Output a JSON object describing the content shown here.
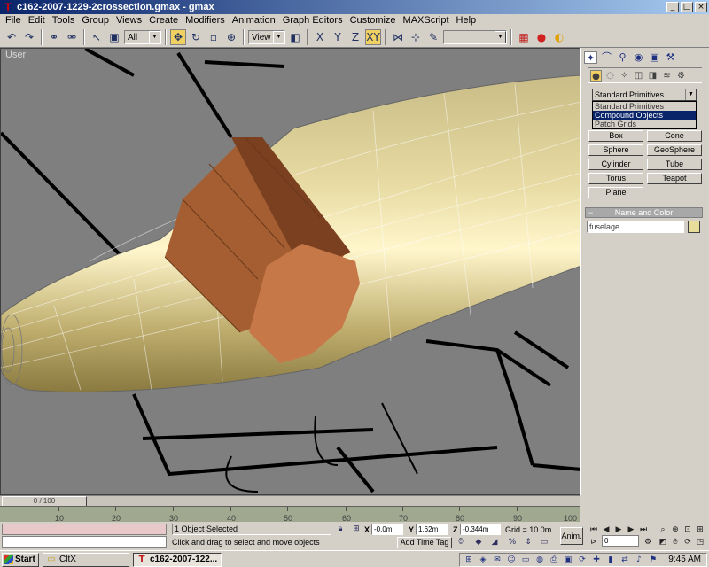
{
  "window": {
    "title": "c162-2007-1229-2crossection.gmax - gmax",
    "app_icon": "gmax-logo-icon",
    "minimize": "_",
    "maximize": "□",
    "close": "×"
  },
  "menu": {
    "items": [
      "File",
      "Edit",
      "Tools",
      "Group",
      "Views",
      "Create",
      "Modifiers",
      "Animation",
      "Graph Editors",
      "Customize",
      "MAXScript",
      "Help"
    ]
  },
  "toolbar": {
    "selection_filter": "All",
    "reference_coord": "View",
    "named_selection": ""
  },
  "viewport": {
    "label": "User"
  },
  "command_panel": {
    "category_selected": "Standard Primitives",
    "category_options": [
      "Standard Primitives",
      "Compound Objects",
      "Patch Grids"
    ],
    "highlighted_option": "Compound Objects",
    "object_types": [
      "Box",
      "Cone",
      "Sphere",
      "GeoSphere",
      "Cylinder",
      "Tube",
      "Torus",
      "Teapot",
      "Plane"
    ],
    "name_color_title": "Name and Color",
    "object_name": "fuselage",
    "object_color": "#e8dc9a"
  },
  "timeline": {
    "slider_label": "0 / 100",
    "ticks": [
      "10",
      "20",
      "30",
      "40",
      "50",
      "60",
      "70",
      "80",
      "90",
      "100"
    ]
  },
  "status": {
    "selection_text": "1 Object Selected",
    "prompt_text": "Click and drag to select and move objects",
    "x_label": "X",
    "x_value": "-0.0m",
    "y_label": "Y",
    "y_value": "1.62m",
    "z_label": "Z",
    "z_value": "-0.344m",
    "grid_text": "Grid = 10.0m",
    "add_time_tag": "Add Time Tag",
    "anim_label": "Anim.",
    "frame_value": "0"
  },
  "taskbar": {
    "start_label": "Start",
    "tasks": [
      {
        "label": "CltX",
        "icon": "folder-icon"
      },
      {
        "label": "c162-2007-122...",
        "icon": "gmax-logo-icon"
      }
    ],
    "clock": "9:45 AM"
  }
}
